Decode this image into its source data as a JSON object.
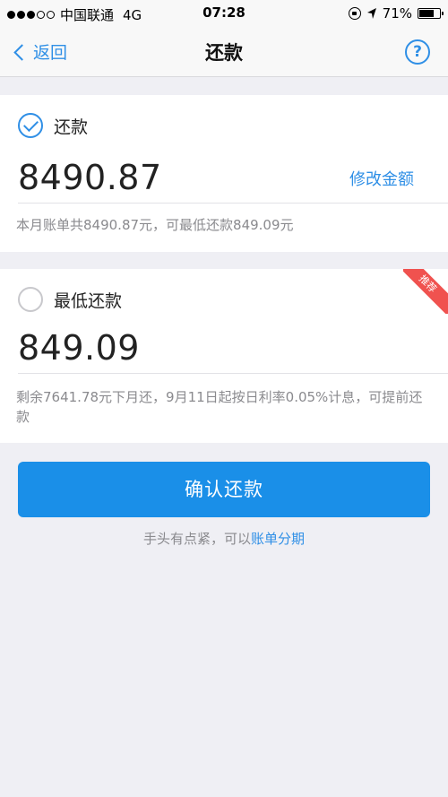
{
  "status_bar": {
    "carrier": "中国联通",
    "network": "4G",
    "time": "07:28",
    "battery": "71%",
    "battery_level": 0.71,
    "signal_bars_filled": 3,
    "signal_bars_total": 5
  },
  "nav": {
    "back_label": "返回",
    "title": "还款",
    "help_label": "?"
  },
  "full_payment": {
    "label": "还款",
    "selected": true,
    "amount": "8490.87",
    "modify_label": "修改金额",
    "note": "本月账单共8490.87元，可最低还款849.09元"
  },
  "minimum_payment": {
    "label": "最低还款",
    "selected": false,
    "amount": "849.09",
    "badge": "推荐",
    "note": "剩余7641.78元下月还，9月11日起按日利率0.05%计息，可提前还款"
  },
  "confirm_button": {
    "label": "确认还款"
  },
  "hint": {
    "text": "手头有点紧，可以",
    "link": "账单分期"
  },
  "colors": {
    "accent": "#2f8fe6",
    "button": "#1a8fe8",
    "badge": "#f0524f",
    "background": "#efeff4"
  }
}
